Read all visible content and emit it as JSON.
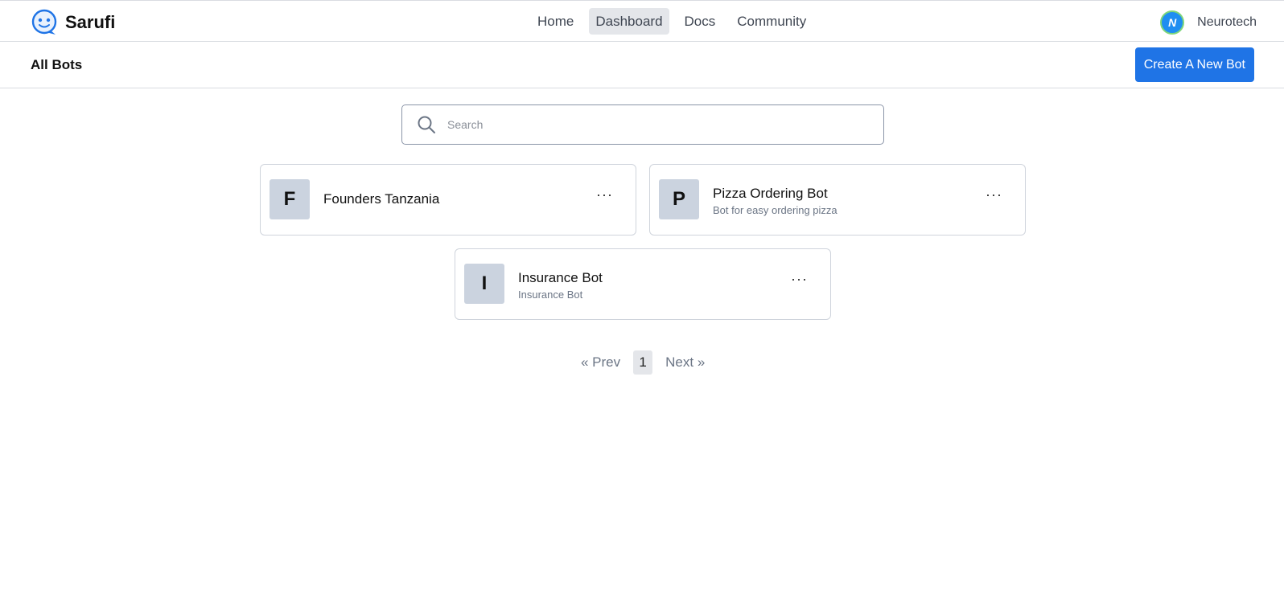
{
  "brand": {
    "name": "Sarufi",
    "logo_icon": "chatbot-face-icon",
    "accent": "#1f74e6"
  },
  "nav": {
    "links": [
      {
        "label": "Home",
        "active": false
      },
      {
        "label": "Dashboard",
        "active": true
      },
      {
        "label": "Docs",
        "active": false
      },
      {
        "label": "Community",
        "active": false
      }
    ]
  },
  "user": {
    "avatar_letter": "N",
    "name": "Neurotech"
  },
  "subheader": {
    "title": "All Bots",
    "create_button": "Create A New Bot"
  },
  "search": {
    "placeholder": "Search",
    "value": ""
  },
  "bots": [
    {
      "letter": "F",
      "name": "Founders Tanzania",
      "description": ""
    },
    {
      "letter": "P",
      "name": "Pizza Ordering Bot",
      "description": "Bot for easy ordering pizza"
    },
    {
      "letter": "I",
      "name": "Insurance Bot",
      "description": "Insurance Bot"
    }
  ],
  "card_menu_label": "···",
  "pagination": {
    "prev": "« Prev",
    "current": "1",
    "next": "Next »"
  }
}
